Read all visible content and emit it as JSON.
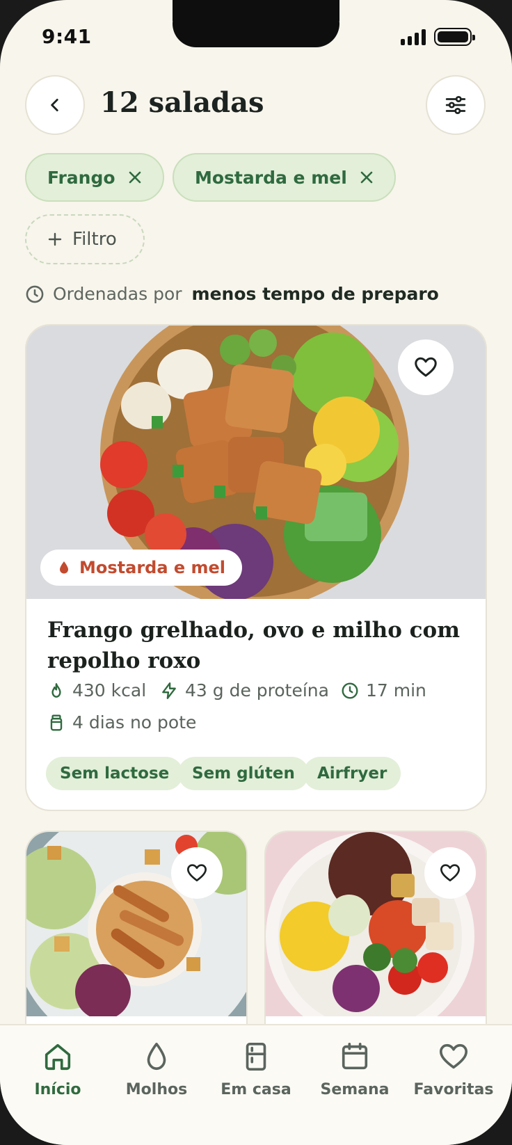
{
  "status_bar": {
    "time": "9:41"
  },
  "header": {
    "title": "12 saladas"
  },
  "filters": {
    "chips": [
      {
        "label": "Frango"
      },
      {
        "label": "Mostarda e mel"
      }
    ],
    "add_label": "Filtro"
  },
  "sort": {
    "prefix": "Ordenadas por",
    "value": "menos tempo de preparo"
  },
  "featured": {
    "sauce_badge": "Mostarda e mel",
    "title": "Frango grelhado, ovo e milho com repolho roxo",
    "calories": "430 kcal",
    "protein": "43 g de proteína",
    "time": "17 min",
    "shelf_life": "4 dias no pote",
    "tags": [
      "Sem lactose",
      "Sem glúten",
      "Airfryer"
    ]
  },
  "tabbar": {
    "items": [
      {
        "label": "Início",
        "icon": "home-icon",
        "active": true
      },
      {
        "label": "Molhos",
        "icon": "drop-icon",
        "active": false
      },
      {
        "label": "Em casa",
        "icon": "fridge-icon",
        "active": false
      },
      {
        "label": "Semana",
        "icon": "calendar-icon",
        "active": false
      },
      {
        "label": "Favoritas",
        "icon": "heart-icon",
        "active": false
      }
    ]
  },
  "colors": {
    "background": "#f8f5ec",
    "accent_green": "#2f6a3f",
    "chip_green": "#e3efd9",
    "sauce_red": "#c24b2f"
  }
}
